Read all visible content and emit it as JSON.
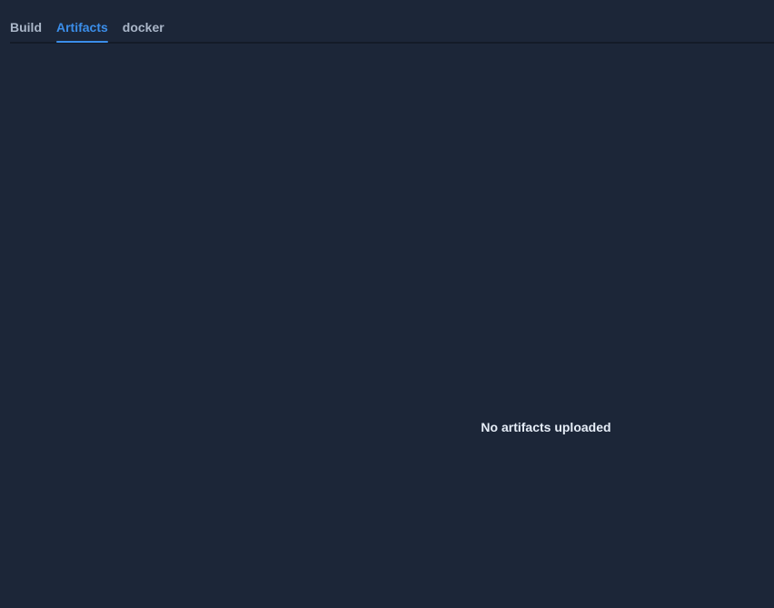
{
  "tabs": [
    {
      "label": "Build",
      "active": false
    },
    {
      "label": "Artifacts",
      "active": true
    },
    {
      "label": "docker",
      "active": false
    }
  ],
  "empty_state": {
    "message": "No artifacts uploaded"
  },
  "colors": {
    "background": "#1c2638",
    "accent": "#3b8eea",
    "tab_text": "#aab6c8",
    "message_text": "#e6edf7"
  }
}
